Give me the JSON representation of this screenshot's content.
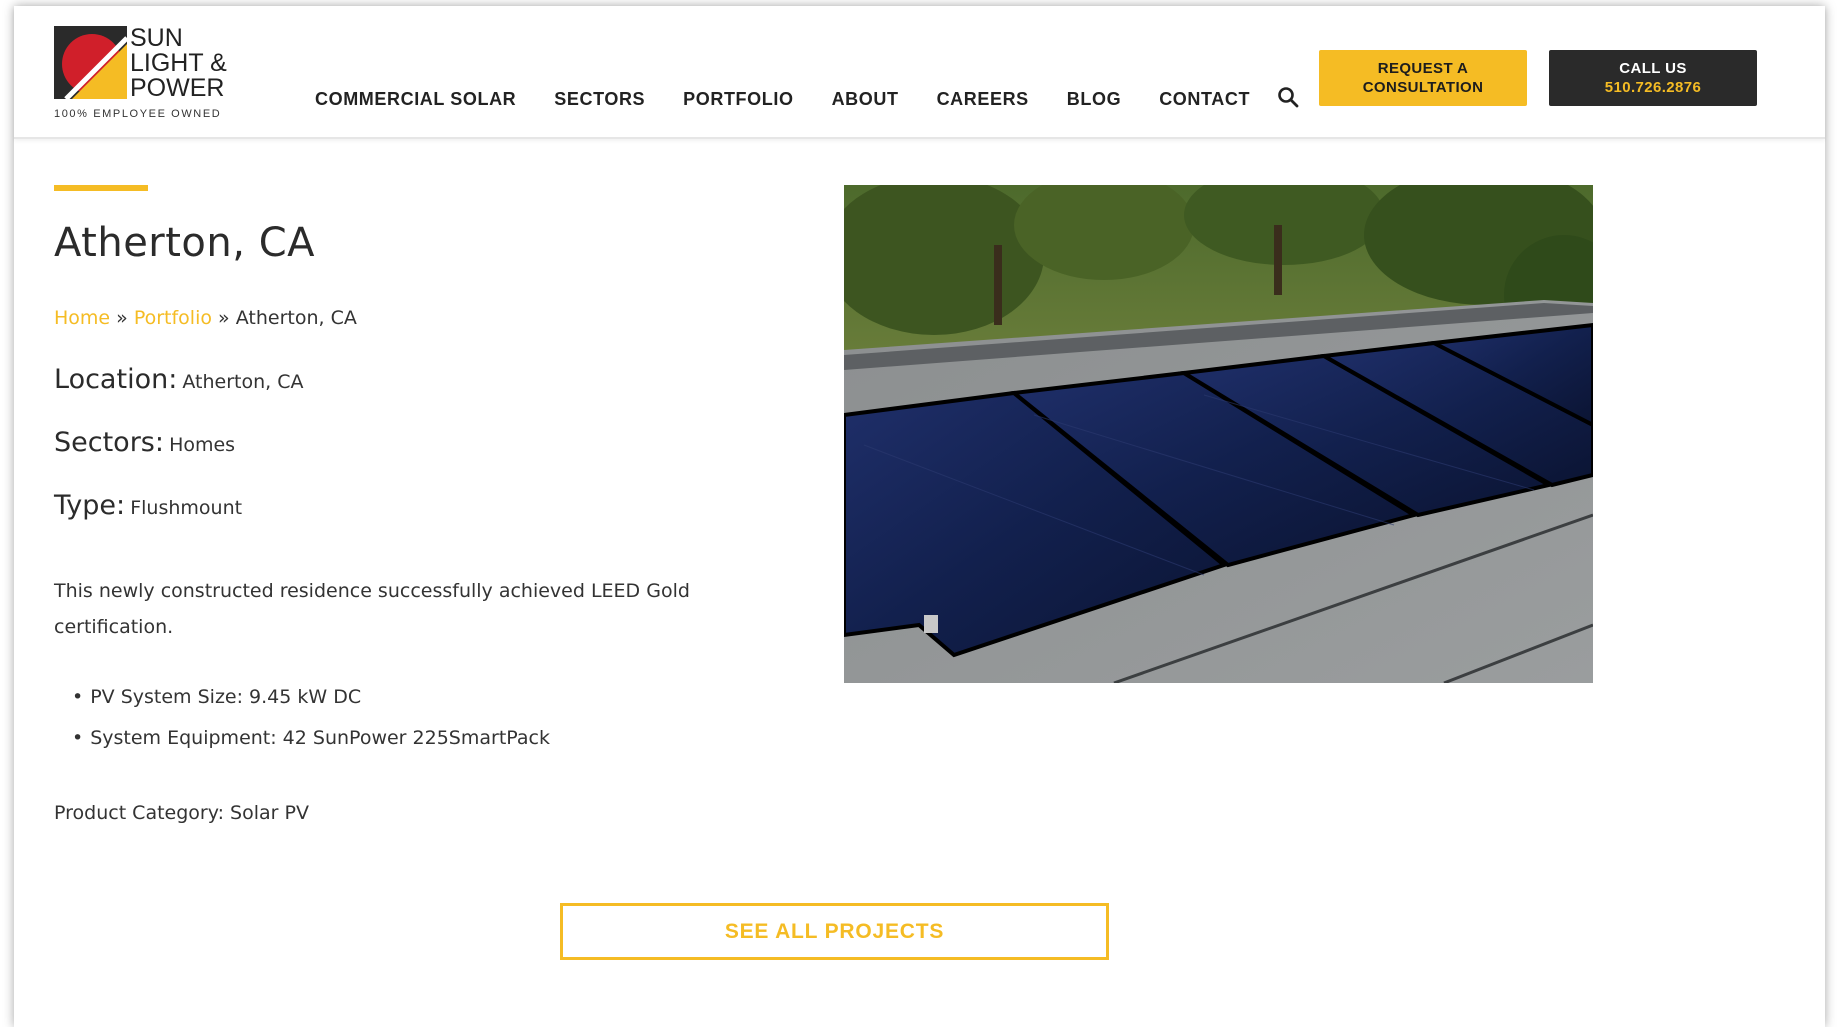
{
  "brand": {
    "name_lines": [
      "SUN",
      "LIGHT &",
      "POWER"
    ],
    "tagline": "100% EMPLOYEE OWNED",
    "accent_color": "#f5bc24",
    "dark_color": "#2a2a2a"
  },
  "nav": {
    "items": [
      "COMMERCIAL SOLAR",
      "SECTORS",
      "PORTFOLIO",
      "ABOUT",
      "CAREERS",
      "BLOG",
      "CONTACT"
    ],
    "search_icon": "search-icon"
  },
  "cta": {
    "consult_line1": "REQUEST A",
    "consult_line2": "CONSULTATION",
    "call_line1": "CALL US",
    "call_line2": "510.726.2876"
  },
  "project": {
    "title": "Atherton, CA",
    "breadcrumb": {
      "home": "Home",
      "sep": "»",
      "portfolio": "Portfolio",
      "current": "Atherton, CA"
    },
    "location_label": "Location:",
    "location_value": "Atherton, CA",
    "sectors_label": "Sectors:",
    "sectors_value": "Homes",
    "type_label": "Type:",
    "type_value": "Flushmount",
    "description": "This newly constructed residence successfully achieved LEED Gold certification.",
    "specs": [
      "PV System Size: 9.45 kW DC",
      "System Equipment: 42 SunPower 225SmartPack"
    ],
    "category": "Product Category: Solar PV",
    "see_all": "SEE ALL PROJECTS"
  }
}
